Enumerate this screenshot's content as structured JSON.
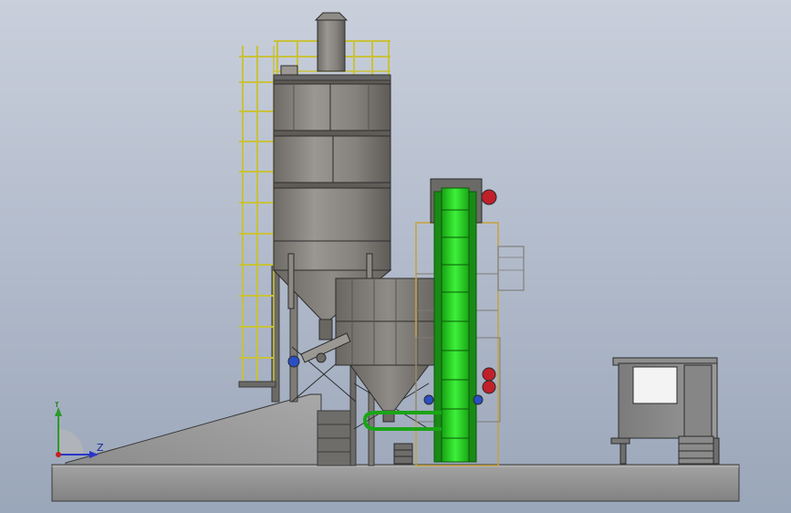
{
  "view": {
    "type": "3D CAD model render",
    "background_gradient": [
      "#c9cfdb",
      "#9aa6b9"
    ]
  },
  "triad": {
    "y_label": "Y",
    "z_label": "Z",
    "colors": {
      "y": "#2a9a2a",
      "z": "#2b35c9",
      "x": "#c81e1e"
    }
  },
  "model": {
    "components": [
      "silo",
      "silo-top-platform",
      "silo-dust-collector",
      "silo-ladder",
      "weigh-hopper",
      "screw-conveyor",
      "bucket-elevator",
      "elevator-motor",
      "ramp",
      "ground-slab",
      "control-cabin"
    ],
    "colors": {
      "steel": "#7d7a76",
      "steel_dark": "#5b5955",
      "rail": "#c8c23a",
      "elevator": "#22d11e",
      "motor": "#c0202a",
      "slab": "#8a8a8a"
    }
  }
}
